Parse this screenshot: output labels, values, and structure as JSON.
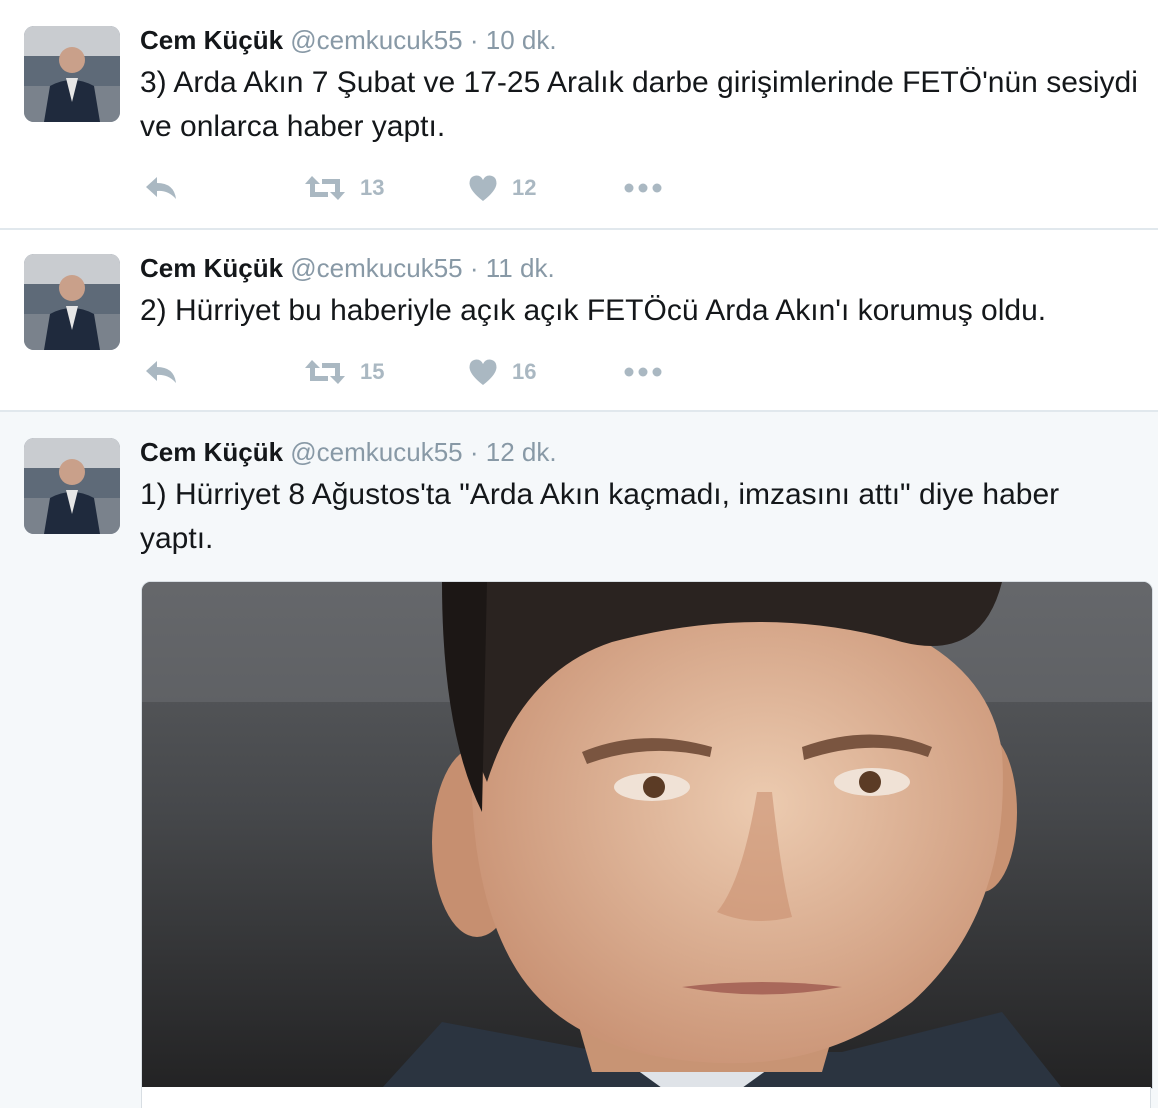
{
  "colors": {
    "text": "#14171a",
    "muted": "#8899a6",
    "action_icon": "#aab8c2",
    "divider": "#e1e8ed",
    "highlight_bg": "#f5f8fa"
  },
  "tweets": [
    {
      "author_name": "Cem Küçük",
      "handle": "@cemkucuk55",
      "separator": "·",
      "time": "10 dk.",
      "text": "3) Arda Akın 7 Şubat ve 17-25 Aralık darbe girişimlerinde FETÖ'nün sesiydi ve onlarca haber yaptı.",
      "retweets": "13",
      "likes": "12",
      "icons": [
        "reply-icon",
        "retweet-icon",
        "heart-icon",
        "more-icon"
      ]
    },
    {
      "author_name": "Cem Küçük",
      "handle": "@cemkucuk55",
      "separator": "·",
      "time": "11 dk.",
      "text": "2) Hürriyet bu haberiyle açık açık FETÖcü Arda Akın'ı korumuş oldu.",
      "retweets": "15",
      "likes": "16",
      "icons": [
        "reply-icon",
        "retweet-icon",
        "heart-icon",
        "more-icon"
      ]
    },
    {
      "author_name": "Cem Küçük",
      "handle": "@cemkucuk55",
      "separator": "·",
      "time": "12 dk.",
      "text": "1) Hürriyet 8 Ağustos'ta \"Arda Akın kaçmadı, imzasını attı\" diye haber yaptı.",
      "media": "photo"
    }
  ]
}
